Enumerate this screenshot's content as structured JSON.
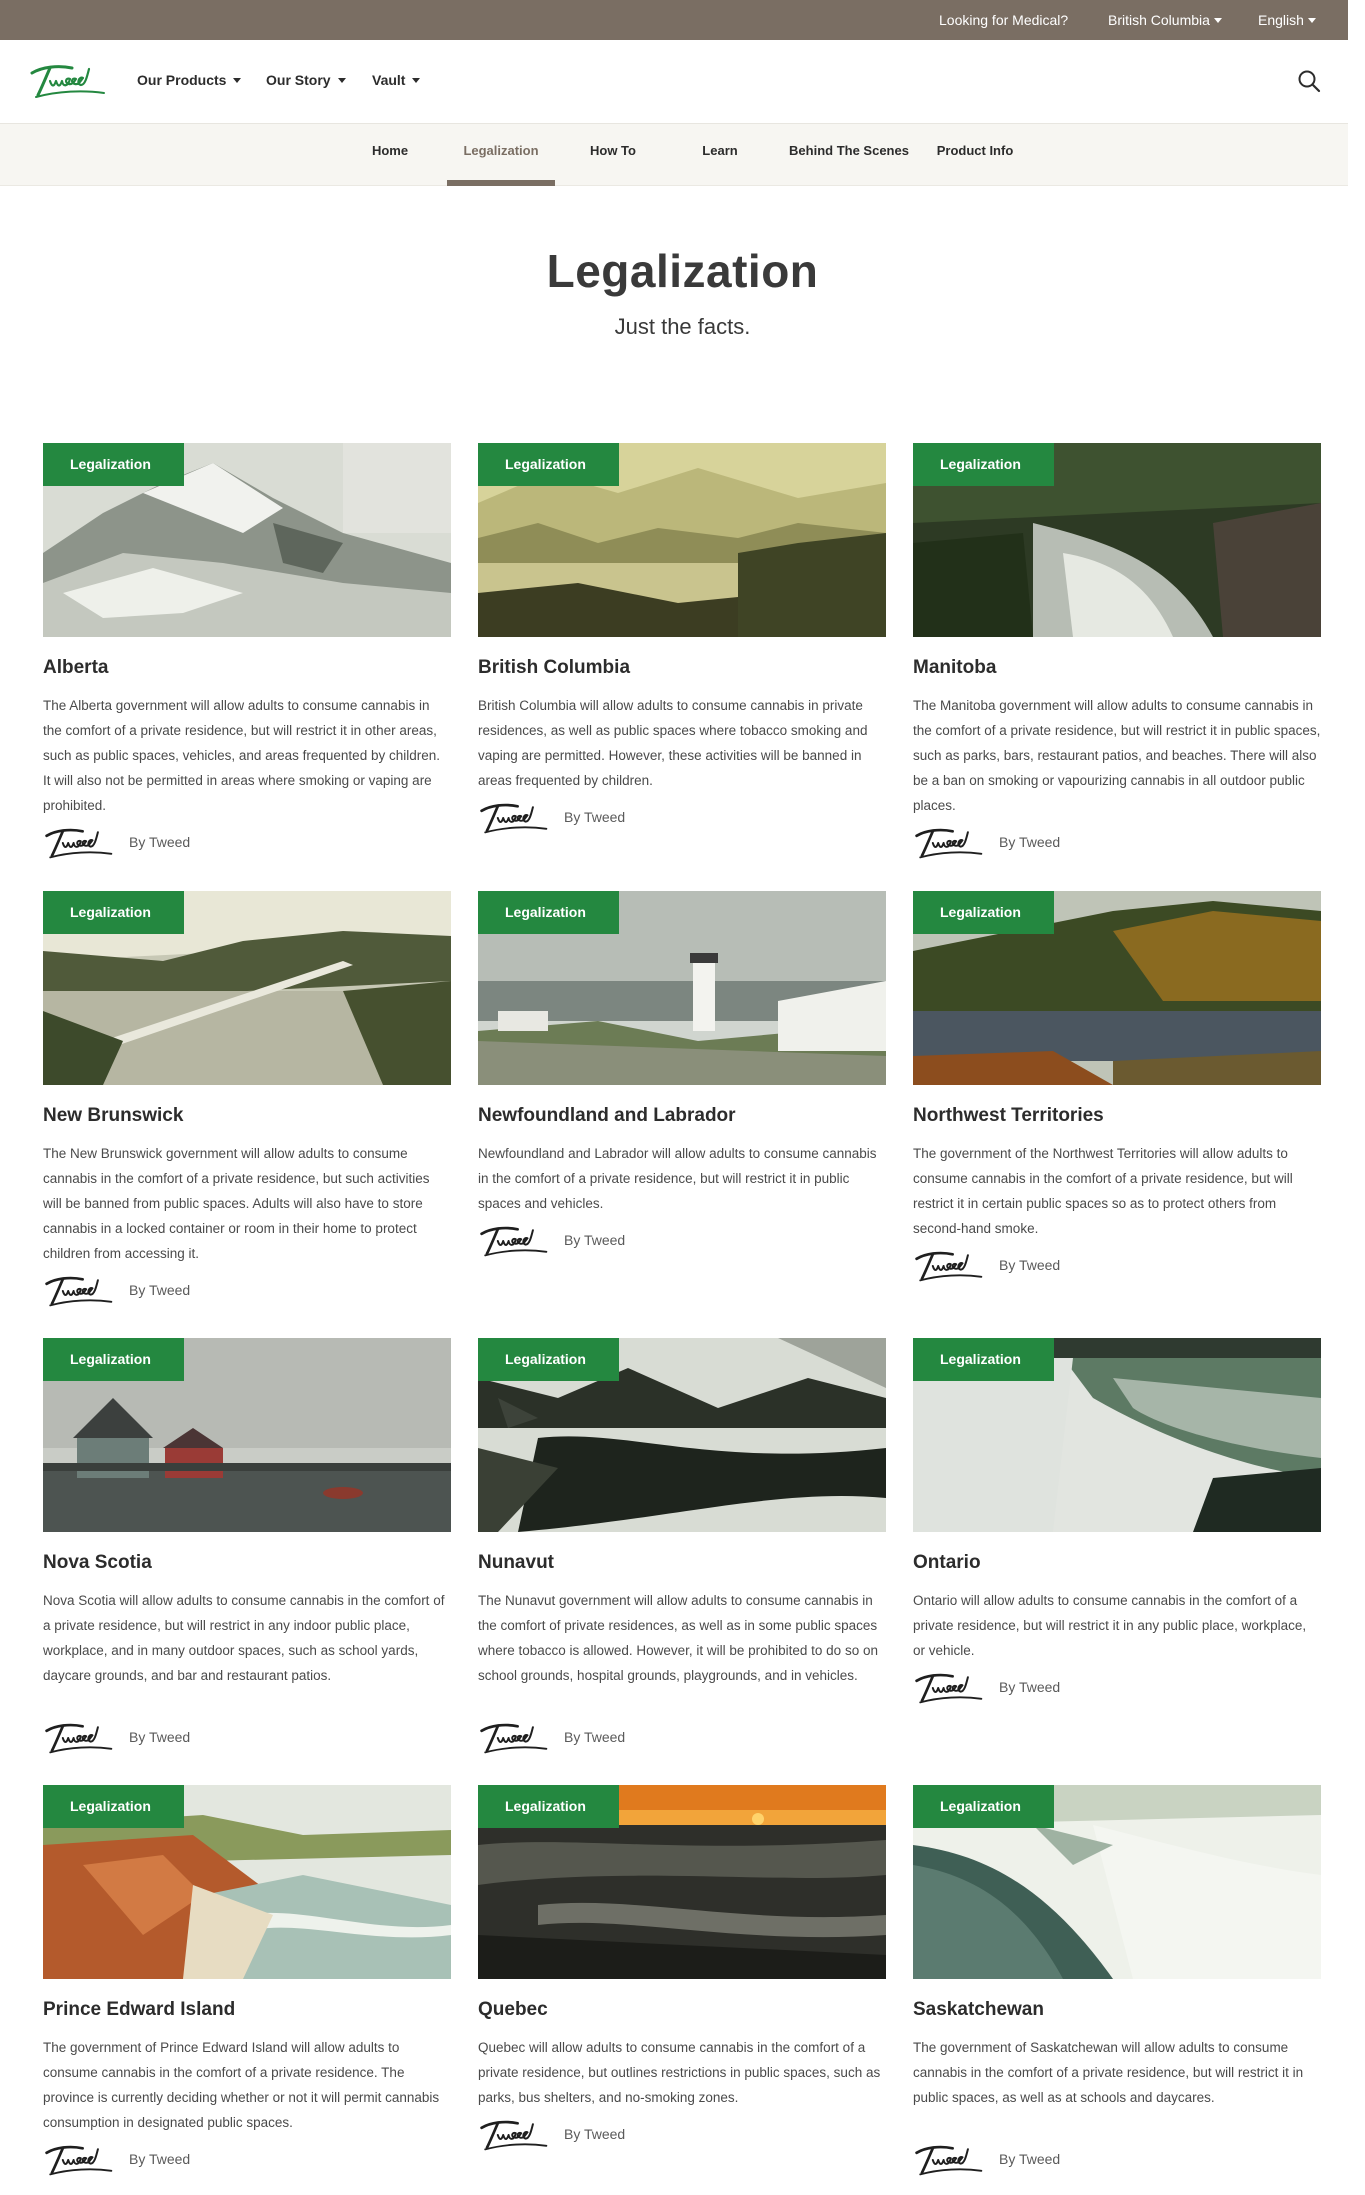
{
  "utility": {
    "medical": "Looking for Medical?",
    "province": "British Columbia",
    "language": "English"
  },
  "brand": {
    "logo_text": "Tweed"
  },
  "nav": {
    "products": "Our Products",
    "story": "Our Story",
    "vault": "Vault"
  },
  "subnav": {
    "home": "Home",
    "legalization": "Legalization",
    "howto": "How To",
    "learn": "Learn",
    "behind": "Behind The Scenes",
    "product_info": "Product Info"
  },
  "hero": {
    "title": "Legalization",
    "subtitle": "Just the facts."
  },
  "colors": {
    "utility_bar": "#7a6e63",
    "badge": "#248840",
    "subnav_bg": "#f7f6f2"
  },
  "cards": [
    {
      "badge": "Legalization",
      "title": "Alberta",
      "desc": "The Alberta government will allow adults to consume cannabis in the comfort of a private residence, but will restrict it in other areas, such as public spaces, vehicles, and areas frequented by children. It will also not be permitted in areas where smoking or vaping are prohibited.",
      "author": "By Tweed"
    },
    {
      "badge": "Legalization",
      "title": "British Columbia",
      "desc": "British Columbia will allow adults to consume cannabis in private residences, as well as public spaces where tobacco smoking and vaping are permitted. However, these activities will be banned in areas frequented by children.",
      "author": "By Tweed"
    },
    {
      "badge": "Legalization",
      "title": "Manitoba",
      "desc": "The Manitoba government will allow adults to consume cannabis in the comfort of a private residence, but will restrict it in public spaces, such as parks, bars, restaurant patios, and beaches. There will also be a ban on smoking or vapourizing cannabis in all outdoor public places.",
      "author": "By Tweed"
    },
    {
      "badge": "Legalization",
      "title": "New Brunswick",
      "desc": "The New Brunswick government will allow adults to consume cannabis in the comfort of a private residence, but such activities will be banned from public spaces. Adults will also have to store cannabis in a locked container or room in their home to protect children from accessing it.",
      "author": "By Tweed"
    },
    {
      "badge": "Legalization",
      "title": "Newfoundland and Labrador",
      "desc": "Newfoundland and Labrador will allow adults to consume cannabis in the comfort of a private residence, but will restrict it in public spaces and vehicles.",
      "author": "By Tweed"
    },
    {
      "badge": "Legalization",
      "title": "Northwest Territories",
      "desc": "The government of the Northwest Territories will allow adults to consume cannabis in the comfort of a private residence, but will restrict it in certain public spaces so as to protect others from second-hand smoke.",
      "author": "By Tweed"
    },
    {
      "badge": "Legalization",
      "title": "Nova Scotia",
      "desc": "Nova Scotia will allow adults to consume cannabis in the comfort of a private residence, but will restrict in any indoor public place, workplace, and in many outdoor spaces, such as school yards, daycare grounds, and bar and restaurant patios.",
      "author": "By Tweed"
    },
    {
      "badge": "Legalization",
      "title": "Nunavut",
      "desc": "The Nunavut government will allow adults to consume cannabis in the comfort of private residences, as well as in some public spaces where tobacco is allowed. However, it will be prohibited to do so on school grounds, hospital grounds, playgrounds, and in vehicles.",
      "author": "By Tweed"
    },
    {
      "badge": "Legalization",
      "title": "Ontario",
      "desc": "Ontario will allow adults to consume cannabis in the comfort of a private residence, but will restrict it in any public place, workplace, or vehicle.",
      "author": "By Tweed"
    },
    {
      "badge": "Legalization",
      "title": "Prince Edward Island",
      "desc": "The government of Prince Edward Island will allow adults to consume cannabis in the comfort of a private residence. The province is currently deciding whether or not it will permit cannabis consumption in designated public spaces.",
      "author": "By Tweed"
    },
    {
      "badge": "Legalization",
      "title": "Quebec",
      "desc": "Quebec will allow adults to consume cannabis in the comfort of a private residence, but outlines restrictions in public spaces, such as parks, bus shelters, and no-smoking zones.",
      "author": "By Tweed"
    },
    {
      "badge": "Legalization",
      "title": "Saskatchewan",
      "desc": "The government of Saskatchewan will allow adults to consume cannabis in the comfort of a private residence, but will restrict it in public spaces, as well as at schools and daycares.",
      "author": "By Tweed"
    }
  ]
}
